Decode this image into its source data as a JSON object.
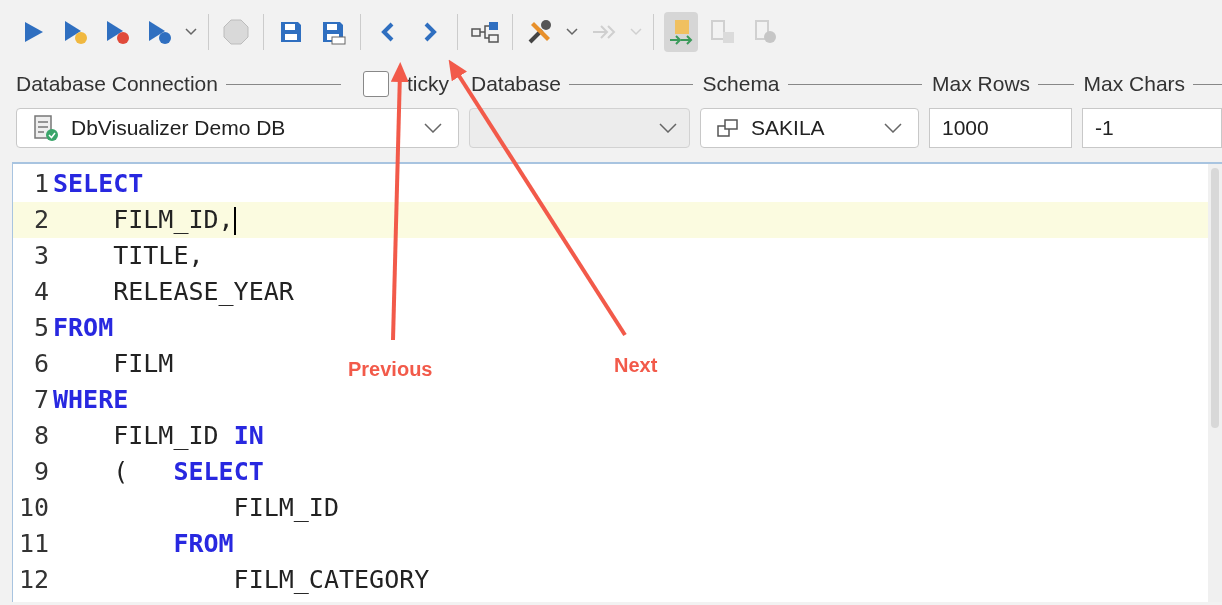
{
  "toolbar": {
    "buttons": [
      {
        "kind": "run",
        "disabled": false
      },
      {
        "kind": "run-yellow",
        "disabled": false
      },
      {
        "kind": "run-red",
        "disabled": false
      },
      {
        "kind": "run-gear",
        "disabled": false
      },
      {
        "kind": "caret",
        "disabled": false
      },
      {
        "kind": "sep"
      },
      {
        "kind": "stop",
        "disabled": true
      },
      {
        "kind": "sep"
      },
      {
        "kind": "save",
        "disabled": false
      },
      {
        "kind": "save-as",
        "disabled": false
      },
      {
        "kind": "sep"
      },
      {
        "kind": "prev",
        "disabled": false
      },
      {
        "kind": "next",
        "disabled": false
      },
      {
        "kind": "sep"
      },
      {
        "kind": "graph",
        "disabled": false
      },
      {
        "kind": "sep"
      },
      {
        "kind": "tools",
        "disabled": false
      },
      {
        "kind": "caret",
        "disabled": false
      },
      {
        "kind": "forward",
        "disabled": true
      },
      {
        "kind": "caret",
        "disabled": true
      },
      {
        "kind": "sep"
      },
      {
        "kind": "export",
        "disabled": false,
        "selected": true
      },
      {
        "kind": "grid-save",
        "disabled": true
      },
      {
        "kind": "grid-rec",
        "disabled": true
      }
    ]
  },
  "connection": {
    "label": "Database Connection",
    "value": "DbVisualizer Demo DB"
  },
  "sticky": {
    "label": "ticky",
    "checked": false
  },
  "database": {
    "label": "Database"
  },
  "schema": {
    "label": "Schema",
    "value": "SAKILA"
  },
  "max_rows": {
    "label": "Max Rows",
    "value": "1000"
  },
  "max_chars": {
    "label": "Max Chars",
    "value": "-1"
  },
  "editor": {
    "lines": [
      {
        "number": "1",
        "current": false,
        "segments": [
          {
            "kind": "keyword",
            "text": "SELECT"
          }
        ]
      },
      {
        "number": "2",
        "current": true,
        "segments": [
          {
            "kind": "plain",
            "text": "    FILM_ID,"
          }
        ]
      },
      {
        "number": "3",
        "current": false,
        "segments": [
          {
            "kind": "plain",
            "text": "    TITLE,"
          }
        ]
      },
      {
        "number": "4",
        "current": false,
        "segments": [
          {
            "kind": "plain",
            "text": "    RELEASE_YEAR"
          }
        ]
      },
      {
        "number": "5",
        "current": false,
        "segments": [
          {
            "kind": "keyword",
            "text": "FROM"
          }
        ]
      },
      {
        "number": "6",
        "current": false,
        "segments": [
          {
            "kind": "plain",
            "text": "    FILM"
          }
        ]
      },
      {
        "number": "7",
        "current": false,
        "segments": [
          {
            "kind": "keyword",
            "text": "WHERE"
          }
        ]
      },
      {
        "number": "8",
        "current": false,
        "segments": [
          {
            "kind": "plain",
            "text": "    FILM_ID "
          },
          {
            "kind": "keyword",
            "text": "IN"
          }
        ]
      },
      {
        "number": "9",
        "current": false,
        "segments": [
          {
            "kind": "plain",
            "text": "    (   "
          },
          {
            "kind": "keyword",
            "text": "SELECT"
          }
        ]
      },
      {
        "number": "10",
        "current": false,
        "segments": [
          {
            "kind": "plain",
            "text": "            FILM_ID"
          }
        ]
      },
      {
        "number": "11",
        "current": false,
        "segments": [
          {
            "kind": "keyword",
            "text": "        FROM"
          }
        ]
      },
      {
        "number": "12",
        "current": false,
        "segments": [
          {
            "kind": "plain",
            "text": "            FILM_CATEGORY"
          }
        ]
      }
    ]
  },
  "annotations": [
    {
      "label": "Previous"
    },
    {
      "label": "Next"
    }
  ]
}
